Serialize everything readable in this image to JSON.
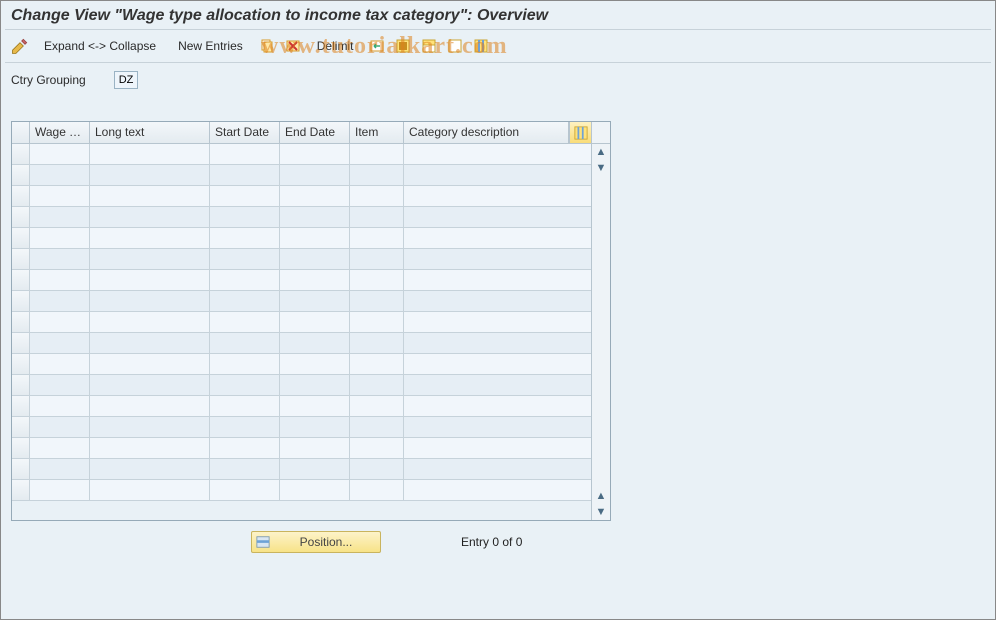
{
  "title": "Change View \"Wage type allocation to income tax category\": Overview",
  "watermark": "www.tutorialkart.com",
  "toolbar": {
    "expand_collapse": "Expand <-> Collapse",
    "new_entries": "New Entries",
    "delimit": "Delimit"
  },
  "form": {
    "ctry_grouping_label": "Ctry Grouping",
    "ctry_grouping_value": "DZ"
  },
  "table": {
    "columns": [
      "Wage Ty...",
      "Long text",
      "Start Date",
      "End Date",
      "Item",
      "Category description"
    ],
    "rows": [
      {
        "wage_type": "",
        "long_text": "",
        "start_date": "",
        "end_date": "",
        "item": "",
        "category": ""
      },
      {
        "wage_type": "",
        "long_text": "",
        "start_date": "",
        "end_date": "",
        "item": "",
        "category": ""
      },
      {
        "wage_type": "",
        "long_text": "",
        "start_date": "",
        "end_date": "",
        "item": "",
        "category": ""
      },
      {
        "wage_type": "",
        "long_text": "",
        "start_date": "",
        "end_date": "",
        "item": "",
        "category": ""
      },
      {
        "wage_type": "",
        "long_text": "",
        "start_date": "",
        "end_date": "",
        "item": "",
        "category": ""
      },
      {
        "wage_type": "",
        "long_text": "",
        "start_date": "",
        "end_date": "",
        "item": "",
        "category": ""
      },
      {
        "wage_type": "",
        "long_text": "",
        "start_date": "",
        "end_date": "",
        "item": "",
        "category": ""
      },
      {
        "wage_type": "",
        "long_text": "",
        "start_date": "",
        "end_date": "",
        "item": "",
        "category": ""
      },
      {
        "wage_type": "",
        "long_text": "",
        "start_date": "",
        "end_date": "",
        "item": "",
        "category": ""
      },
      {
        "wage_type": "",
        "long_text": "",
        "start_date": "",
        "end_date": "",
        "item": "",
        "category": ""
      },
      {
        "wage_type": "",
        "long_text": "",
        "start_date": "",
        "end_date": "",
        "item": "",
        "category": ""
      },
      {
        "wage_type": "",
        "long_text": "",
        "start_date": "",
        "end_date": "",
        "item": "",
        "category": ""
      },
      {
        "wage_type": "",
        "long_text": "",
        "start_date": "",
        "end_date": "",
        "item": "",
        "category": ""
      },
      {
        "wage_type": "",
        "long_text": "",
        "start_date": "",
        "end_date": "",
        "item": "",
        "category": ""
      },
      {
        "wage_type": "",
        "long_text": "",
        "start_date": "",
        "end_date": "",
        "item": "",
        "category": ""
      },
      {
        "wage_type": "",
        "long_text": "",
        "start_date": "",
        "end_date": "",
        "item": "",
        "category": ""
      },
      {
        "wage_type": "",
        "long_text": "",
        "start_date": "",
        "end_date": "",
        "item": "",
        "category": ""
      }
    ]
  },
  "footer": {
    "position_label": "Position...",
    "entry_text": "Entry 0 of 0"
  }
}
